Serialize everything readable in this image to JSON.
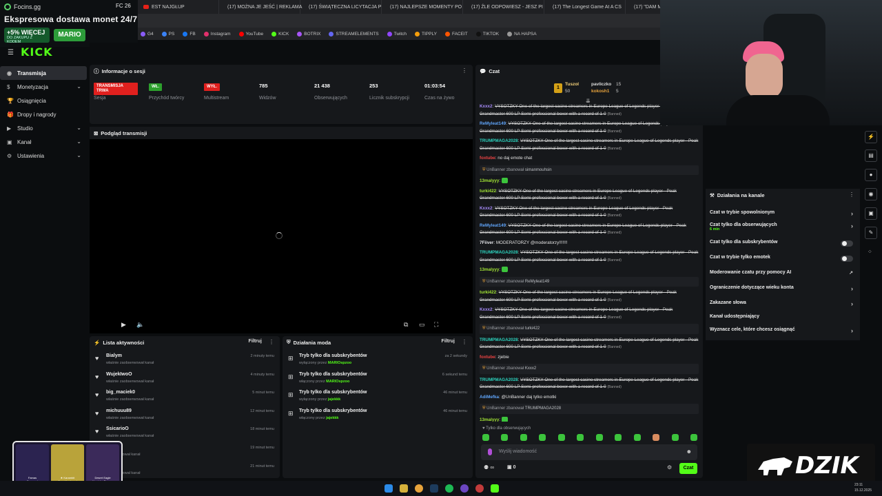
{
  "browser_tabs": [
    "EST NAJGŁUP",
    "(17) MOŻNA JE JEŚĆ | REKLAMA",
    "(17) ŚWIĄTECZNA LICYTACJA P",
    "(17) NAJLEPSZE MOMENTY PO",
    "(17) ŹLE ODPOWIESZ - JESZ PI",
    "(17) The Longest Game At A CS",
    "(17) \"DAM MU W MORDĘ ZA T"
  ],
  "bookmarks": [
    "G4",
    "PS",
    "FB",
    "Instagram",
    "YouTube",
    "KICK",
    "BOTRIX",
    "STREAMELEMENTS",
    "Twitch",
    "TIPPLY",
    "FACEIT",
    "TIKTOK",
    "NA HAPSA"
  ],
  "promo": {
    "brand": "Focins.gg",
    "fc": "FC 26",
    "headline": "Ekspresowa dostawa monet 24/7",
    "bonus": "+5% WIĘCEJ",
    "bonus_sub": "DO ZAKUPU Z KODEM",
    "code": "MARIO"
  },
  "logo": "KICK",
  "sidebar": {
    "items": [
      {
        "label": "Transmisja",
        "icon": "broadcast-icon",
        "active": true
      },
      {
        "label": "Monetyzacja",
        "icon": "dollar-icon",
        "chevron": true
      },
      {
        "label": "Osiągnięcia",
        "icon": "trophy-icon"
      },
      {
        "label": "Dropy i nagrody",
        "icon": "gift-icon"
      },
      {
        "label": "Studio",
        "icon": "camera-icon",
        "chevron": true
      },
      {
        "label": "Kanał",
        "icon": "user-icon",
        "chevron": true
      },
      {
        "label": "Ustawienia",
        "icon": "gear-icon",
        "chevron": true
      }
    ]
  },
  "session": {
    "title": "Informacje o sesji",
    "stats": [
      {
        "value": "TRANSMISJA TRWA",
        "label": "Sesja",
        "badge": "red"
      },
      {
        "value": "WŁ.",
        "label": "Przychód twórcy",
        "badge": "green"
      },
      {
        "value": "WYŁ.",
        "label": "Multistream",
        "badge": "red"
      },
      {
        "value": "785",
        "label": "Widzów"
      },
      {
        "value": "21 438",
        "label": "Obserwujących"
      },
      {
        "value": "253",
        "label": "Licznik subskrypcji"
      },
      {
        "value": "01:03:54",
        "label": "Czas na żywo"
      }
    ]
  },
  "preview": {
    "title": "Podgląd transmisji"
  },
  "activity": {
    "title": "Lista aktywności",
    "filter": "Filtruj",
    "items": [
      {
        "user": "Bialym",
        "desc": "właśnie zaobserwował kanał",
        "time": "2 minuty temu"
      },
      {
        "user": "WujekIwoO",
        "desc": "właśnie zaobserwował kanał",
        "time": "4 minuty temu"
      },
      {
        "user": "big_maciek0",
        "desc": "właśnie zaobserwował kanał",
        "time": "5 minut temu"
      },
      {
        "user": "michuuu89",
        "desc": "właśnie zaobserwował kanał",
        "time": "12 minut temu"
      },
      {
        "user": "SsicarioO",
        "desc": "właśnie zaobserwował kanał",
        "time": "18 minut temu"
      },
      {
        "user": "k",
        "desc": "zaobserwował kanał",
        "time": "19 minut temu"
      },
      {
        "user": "lek",
        "desc": "zaobserwował kanał",
        "time": "21 minut temu"
      }
    ]
  },
  "mod": {
    "title": "Działania moda",
    "filter": "Filtruj",
    "items": [
      {
        "title": "Tryb tylko dla subskrybentów",
        "prefix": "wyłączony przez",
        "user": "MARIOspzoo",
        "time": "za 2 sekundy"
      },
      {
        "title": "Tryb tylko dla subskrybentów",
        "prefix": "włączony przez",
        "user": "MARIOspzoo",
        "time": "6 sekund temu"
      },
      {
        "title": "Tryb tylko dla subskrybentów",
        "prefix": "wyłączony przez",
        "user": "jajekkk",
        "time": "46 minut temu"
      },
      {
        "title": "Tryb tylko dla subskrybentów",
        "prefix": "włączony przez",
        "user": "jajekkk",
        "time": "46 minut temu"
      }
    ]
  },
  "chat": {
    "title": "Czat",
    "leaders": [
      {
        "name": "Tuszol",
        "n": "50"
      },
      {
        "name": "pavliczko",
        "n": "15"
      },
      {
        "name": "kokosh1",
        "n": "5"
      }
    ],
    "spam": "VYSOTZKY One of the largest casino streamers in Europe League of Legends player - Peak Grandmaster 600 LP Semi-professional boxer with a record of 1-0",
    "banned": "(Banned)",
    "messages": [
      {
        "type": "msg",
        "user": "Kxxx2",
        "color": "#a78bfa",
        "spam": true
      },
      {
        "type": "msg",
        "user": "ReMyleat149",
        "color": "#60a5fa",
        "spam": true
      },
      {
        "type": "msg",
        "user": "TRUMPMAGA2028",
        "color": "#2dd4bf",
        "spam": true
      },
      {
        "type": "msg",
        "user": "foxtube",
        "color": "#ef4444",
        "text": "no daj emote chat"
      },
      {
        "type": "sys",
        "actor": "UnBanner",
        "verb": "zbanował",
        "target": "simanmouhsin"
      },
      {
        "type": "msg",
        "user": "13malyyy",
        "color": "#a3e635",
        "text": ""
      },
      {
        "type": "msg",
        "user": "turki422",
        "color": "#a3e635",
        "spam": true
      },
      {
        "type": "msg",
        "user": "Kxxx2",
        "color": "#a78bfa",
        "spam": true
      },
      {
        "type": "msg",
        "user": "ReMyleat149",
        "color": "#60a5fa",
        "spam": true
      },
      {
        "type": "msg",
        "user": "7Fiiver",
        "color": "#e5e7eb",
        "text": "MODERATORZY @moderatorzy!!!!!!!"
      },
      {
        "type": "msg",
        "user": "TRUMPMAGA2028",
        "color": "#2dd4bf",
        "spam": true
      },
      {
        "type": "msg",
        "user": "13malyyy",
        "color": "#a3e635",
        "text": ""
      },
      {
        "type": "sys",
        "actor": "UnBanner",
        "verb": "zbanował",
        "target": "ReMyleat149"
      },
      {
        "type": "msg",
        "user": "turki422",
        "color": "#a3e635",
        "spam": true
      },
      {
        "type": "msg",
        "user": "Kxxx2",
        "color": "#a78bfa",
        "spam": true
      },
      {
        "type": "sys",
        "actor": "UnBanner",
        "verb": "zbanował",
        "target": "turki422"
      },
      {
        "type": "msg",
        "user": "TRUMPMAGA2028",
        "color": "#2dd4bf",
        "spam": true
      },
      {
        "type": "msg",
        "user": "foxtube",
        "color": "#ef4444",
        "text": "zjebie"
      },
      {
        "type": "sys",
        "actor": "UnBanner",
        "verb": "zbanował",
        "target": "Kxxx2"
      },
      {
        "type": "msg",
        "user": "TRUMPMAGA2028",
        "color": "#2dd4bf",
        "spam": true
      },
      {
        "type": "msg",
        "user": "AdiMefka",
        "color": "#60a5fa",
        "text": "@UnBanner daj tylko emotki"
      },
      {
        "type": "sys",
        "actor": "UnBanner",
        "verb": "zbanował",
        "target": "TRUMPMAGA2028"
      },
      {
        "type": "msg",
        "user": "13malyyy",
        "color": "#a3e635",
        "text": ""
      }
    ],
    "followers_only": "Tylko dla obserwujących",
    "placeholder": "Wyślij wiadomość",
    "send": "Czat",
    "viewer_count": "0"
  },
  "actions": {
    "title": "Działania na kanale",
    "items": [
      {
        "label": "Czat w trybie spowolnionym",
        "kind": "chevron"
      },
      {
        "label": "Czat tylko dla obserwujących",
        "sub": "6 min",
        "kind": "chevron"
      },
      {
        "label": "Czat tylko dla subskrybentów",
        "kind": "toggle"
      },
      {
        "label": "Czat w trybie tylko emotek",
        "kind": "toggle"
      },
      {
        "label": "Moderowanie czatu przy pomocy AI",
        "kind": "external"
      },
      {
        "label": "Ograniczenie dotyczące wieku konta",
        "kind": "chevron"
      },
      {
        "label": "Zakazane słowa",
        "kind": "chevron"
      },
      {
        "label": "Kanał udostępniający",
        "kind": "none"
      },
      {
        "label": "Wyznacz cele, które chcesz osiągnąć",
        "kind": "chevron"
      }
    ]
  },
  "skins": [
    {
      "name": "Famas",
      "sub": "Sergeant"
    },
    {
      "name": "★ Karambit",
      "sub": "Case Hardened"
    },
    {
      "name": "Desert Eagle",
      "sub": "Kumicho Dragon"
    }
  ],
  "overlay_brand": "DZIK",
  "clock": {
    "time": "23:11",
    "date": "15.12.2025"
  },
  "colors": {
    "kick_green": "#53fc18",
    "live_red": "#e0201e",
    "panel": "#16181b"
  }
}
